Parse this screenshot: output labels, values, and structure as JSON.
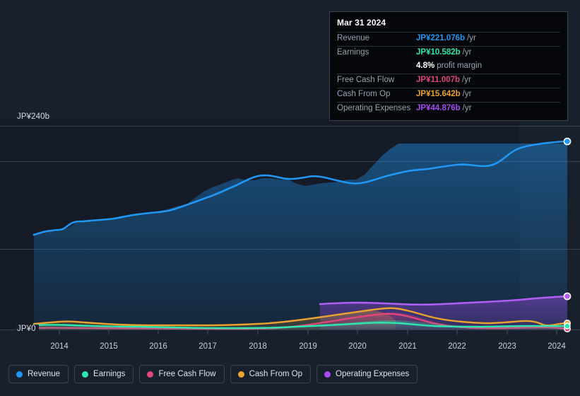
{
  "axis": {
    "y_top_label": "JP¥240b",
    "y_zero_label": "JP¥0",
    "x_ticks": [
      "2014",
      "2015",
      "2016",
      "2017",
      "2018",
      "2019",
      "2020",
      "2021",
      "2022",
      "2023",
      "2024"
    ]
  },
  "tooltip": {
    "date": "Mar 31 2024",
    "rows": [
      {
        "key": "Revenue",
        "value": "JP¥221.076b",
        "unit": "/yr",
        "color": "#2196f3"
      },
      {
        "key": "Earnings",
        "value": "JP¥10.582b",
        "unit": "/yr",
        "color": "#2ee6b0"
      },
      {
        "key": "Free Cash Flow",
        "value": "JP¥11.007b",
        "unit": "/yr",
        "color": "#e0457b"
      },
      {
        "key": "Cash From Op",
        "value": "JP¥15.642b",
        "unit": "/yr",
        "color": "#eaa22e"
      },
      {
        "key": "Operating Expenses",
        "value": "JP¥44.876b",
        "unit": "/yr",
        "color": "#a64bf4"
      }
    ],
    "profit_margin_value": "4.8%",
    "profit_margin_label": "profit margin"
  },
  "legend": [
    {
      "label": "Revenue",
      "color": "#2196f3"
    },
    {
      "label": "Earnings",
      "color": "#2ee6b0"
    },
    {
      "label": "Free Cash Flow",
      "color": "#e0457b"
    },
    {
      "label": "Cash From Op",
      "color": "#eaa22e"
    },
    {
      "label": "Operating Expenses",
      "color": "#a64bf4"
    }
  ],
  "chart_data": {
    "type": "area",
    "title": "",
    "xlabel": "",
    "ylabel": "JP¥ (billions)",
    "ylim": [
      0,
      240
    ],
    "grid": true,
    "legend_position": "bottom",
    "currency": "JP¥",
    "unit": "b",
    "period": "/yr",
    "x": [
      2013.4,
      2013.75,
      2014.0,
      2014.25,
      2014.5,
      2014.75,
      2015.0,
      2015.25,
      2015.5,
      2015.75,
      2016.0,
      2016.25,
      2016.5,
      2016.75,
      2017.0,
      2017.25,
      2017.5,
      2017.75,
      2018.0,
      2018.25,
      2018.5,
      2018.75,
      2019.0,
      2019.25,
      2019.5,
      2019.75,
      2020.0,
      2020.25,
      2020.5,
      2020.75,
      2021.0,
      2021.25,
      2021.5,
      2021.75,
      2022.0,
      2022.25,
      2022.5,
      2022.75,
      2023.0,
      2023.25,
      2023.5,
      2023.75,
      2024.0,
      2024.25
    ],
    "series": [
      {
        "name": "Revenue",
        "color": "#2196f3",
        "values": [
          111,
          114,
          117,
          117,
          118,
          126,
          127,
          128,
          129,
          130,
          133,
          135,
          137,
          138,
          139,
          140,
          143,
          146,
          148,
          155,
          163,
          168,
          172,
          176,
          180,
          177,
          177,
          180,
          180,
          178,
          178,
          173,
          170,
          172,
          174,
          175,
          176,
          178,
          178,
          184,
          195,
          206,
          215,
          221.076
        ],
        "final_value": 221.076
      },
      {
        "name": "Earnings",
        "color": "#2ee6b0",
        "values": [
          5.0,
          5.2,
          5.4,
          5.3,
          5.2,
          5.0,
          4.8,
          4.6,
          4.4,
          4.2,
          4.0,
          3.9,
          3.8,
          3.7,
          3.6,
          3.5,
          3.4,
          3.2,
          3.0,
          2.8,
          2.6,
          2.7,
          3.0,
          3.2,
          3.6,
          4.0,
          4.6,
          5.4,
          6.2,
          7.0,
          7.6,
          8.0,
          7.8,
          7.2,
          6.6,
          6.2,
          6.0,
          6.0,
          6.2,
          6.8,
          7.8,
          8.8,
          9.8,
          10.582
        ],
        "final_value": 10.582
      },
      {
        "name": "Free Cash Flow",
        "color": "#e0457b",
        "values": [
          1.6,
          1.7,
          1.8,
          1.8,
          1.7,
          1.6,
          1.6,
          1.5,
          1.5,
          1.4,
          1.4,
          1.4,
          1.4,
          1.3,
          1.3,
          1.3,
          1.2,
          1.2,
          1.2,
          1.4,
          2.4,
          3.2,
          3.8,
          4.4,
          5.0,
          5.8,
          6.6,
          8.0,
          9.4,
          10.6,
          11.6,
          12.0,
          11.4,
          10.2,
          8.8,
          7.6,
          6.8,
          6.4,
          6.2,
          6.4,
          7.4,
          8.6,
          10.0,
          11.007
        ],
        "final_value": 11.007
      },
      {
        "name": "Cash From Op",
        "color": "#eaa22e",
        "values": [
          6.4,
          6.8,
          7.2,
          7.4,
          7.6,
          7.8,
          7.6,
          7.2,
          6.8,
          6.6,
          6.4,
          6.4,
          6.4,
          6.3,
          6.2,
          6.2,
          6.2,
          6.2,
          6.3,
          6.6,
          7.2,
          8.0,
          8.6,
          9.2,
          9.8,
          10.6,
          11.4,
          12.8,
          14.2,
          15.4,
          16.4,
          16.8,
          16.2,
          15.0,
          13.6,
          12.4,
          11.6,
          11.2,
          11.0,
          11.4,
          12.6,
          13.8,
          14.9,
          15.642
        ],
        "final_value": 15.642
      },
      {
        "name": "Operating Expenses",
        "color": "#a64bf4",
        "starts_at_x": 2019.0,
        "values": [
          null,
          null,
          null,
          null,
          null,
          null,
          null,
          null,
          null,
          null,
          null,
          null,
          null,
          null,
          null,
          null,
          null,
          null,
          null,
          null,
          null,
          null,
          40.2,
          40.4,
          40.5,
          40.4,
          40.2,
          40.0,
          39.8,
          39.6,
          39.4,
          39.4,
          39.6,
          39.8,
          40.0,
          40.2,
          40.5,
          40.8,
          41.2,
          41.8,
          42.6,
          43.4,
          44.2,
          44.876
        ],
        "final_value": 44.876
      }
    ],
    "gridlines_y": [
      240,
      198,
      95,
      0
    ],
    "forecast_boundary_x": 2023.25
  }
}
